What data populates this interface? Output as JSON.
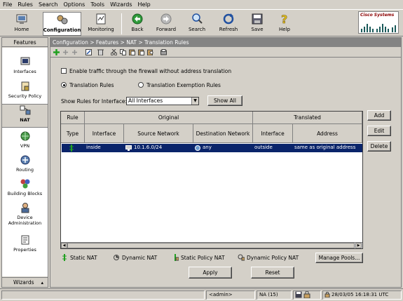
{
  "menu": [
    "File",
    "Rules",
    "Search",
    "Options",
    "Tools",
    "Wizards",
    "Help"
  ],
  "toolbar": {
    "home": "Home",
    "configuration": "Configuration",
    "monitoring": "Monitoring",
    "back": "Back",
    "forward": "Forward",
    "search": "Search",
    "refresh": "Refresh",
    "save": "Save",
    "help": "Help"
  },
  "brand": "Cisco Systems",
  "sidebar": {
    "header": "Features",
    "items": [
      "Interfaces",
      "Security Policy",
      "NAT",
      "VPN",
      "Routing",
      "Building Blocks",
      "Device Administration",
      "Properties"
    ],
    "selected": "NAT",
    "footer": "Wizards"
  },
  "breadcrumb": "Configuration > Features > NAT > Translation Rules",
  "options": {
    "enable_traffic": "Enable traffic through the firewall without address translation",
    "translation_rules": "Translation Rules",
    "exemption_rules": "Translation Exemption Rules",
    "show_rules_label": "Show Rules for Interface:",
    "interface_value": "All Interfaces",
    "show_all": "Show All"
  },
  "table": {
    "group_headers": {
      "rule": "Rule",
      "original": "Original",
      "translated": "Translated"
    },
    "columns": [
      "Type",
      "Interface",
      "Source Network",
      "Destination Network",
      "Interface",
      "Address"
    ],
    "rows": [
      {
        "type": "",
        "interface": "inside",
        "source": "10.1.6.0/24",
        "destination": "any",
        "t_interface": "outside",
        "address": "same as original address"
      }
    ]
  },
  "side_buttons": {
    "add": "Add",
    "edit": "Edit",
    "delete": "Delete"
  },
  "legend": [
    "Static NAT",
    "Dynamic NAT",
    "Static Policy NAT",
    "Dynamic Policy NAT"
  ],
  "manage_pools": "Manage Pools...",
  "apply": "Apply",
  "reset": "Reset",
  "status": {
    "user": "<admin>",
    "level": "NA (15)",
    "datetime": "28/03/05 16:18:31 UTC"
  }
}
